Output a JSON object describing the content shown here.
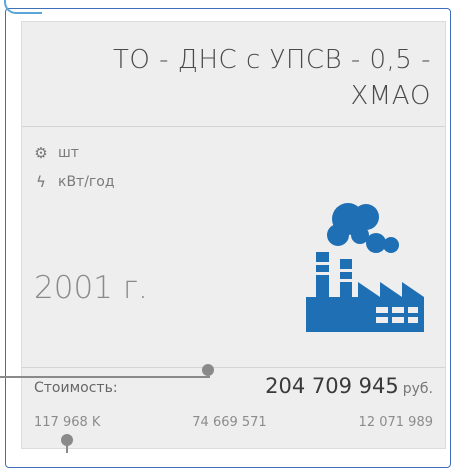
{
  "card": {
    "title": "ТО - ДНС с УПСВ - 0,5 - ХМАО",
    "properties": [
      {
        "icon": "gear-icon",
        "label": "шт"
      },
      {
        "icon": "lightning-icon",
        "label": "кВт/год"
      }
    ],
    "year": "2001 г.",
    "image_icon": "factory-icon",
    "cost": {
      "label": "Стоимость:",
      "value": "204 709 945",
      "currency": "руб."
    },
    "stats": [
      "117 968 K",
      "74 669 571",
      "12 071 989"
    ]
  },
  "colors": {
    "accent": "#1f6fb5",
    "frame": "#3f6fb8",
    "card_bg": "#eeeeee"
  }
}
